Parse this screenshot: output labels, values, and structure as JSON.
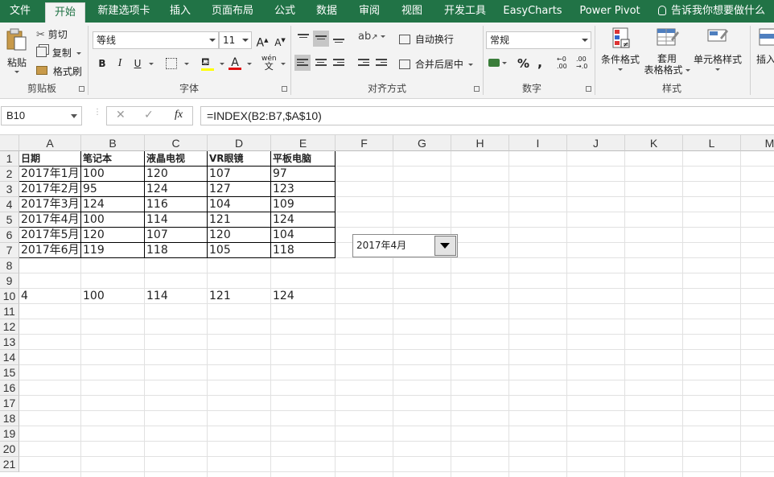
{
  "menu": {
    "tabs": [
      "文件",
      "开始",
      "新建选项卡",
      "插入",
      "页面布局",
      "公式",
      "数据",
      "审阅",
      "视图",
      "开发工具",
      "EasyCharts",
      "Power Pivot"
    ],
    "active_tab": "开始",
    "tell_me": "告诉我你想要做什么"
  },
  "ribbon": {
    "clipboard": {
      "paste": "粘贴",
      "cut": "剪切",
      "copy": "复制",
      "format_painter": "格式刷",
      "label": "剪贴板"
    },
    "font": {
      "font_name": "等线",
      "font_size": "11",
      "bold": "B",
      "italic": "I",
      "underline": "U",
      "grow": "A",
      "shrink": "A",
      "font_color": "A",
      "phonetic": "wén",
      "phonetic_char": "文",
      "label": "字体"
    },
    "alignment": {
      "wrap_text": "自动换行",
      "merge_center": "合并后居中",
      "label": "对齐方式"
    },
    "number": {
      "format": "常规",
      "percent": "%",
      "comma": ",",
      "inc_decimal_top": "←0",
      "inc_decimal_bottom": ".00",
      "dec_decimal_top": ".00",
      "dec_decimal_bottom": "→.0",
      "label": "数字"
    },
    "styles": {
      "conditional": "条件格式",
      "table_line1": "套用",
      "table_line2": "表格格式",
      "cell_styles": "单元格样式",
      "label": "样式"
    },
    "cells": {
      "insert": "插入"
    }
  },
  "formula_bar": {
    "name_box": "B10",
    "cancel": "✕",
    "enter": "✓",
    "fx": "fx",
    "formula": "=INDEX(B2:B7,$A$10)"
  },
  "sheet": {
    "columns": [
      "A",
      "B",
      "C",
      "D",
      "E",
      "F",
      "G",
      "H",
      "I",
      "J",
      "K",
      "L",
      "M"
    ],
    "rows": [
      "1",
      "2",
      "3",
      "4",
      "5",
      "6",
      "7",
      "8",
      "9",
      "10",
      "11",
      "12",
      "13",
      "14",
      "15",
      "16",
      "17",
      "18",
      "19",
      "20",
      "21"
    ],
    "table_header": [
      "日期",
      "笔记本",
      "液晶电视",
      "VR眼镜",
      "平板电脑"
    ],
    "table_rows": [
      [
        "2017年1月",
        "100",
        "120",
        "107",
        "97"
      ],
      [
        "2017年2月",
        "95",
        "124",
        "127",
        "123"
      ],
      [
        "2017年3月",
        "124",
        "116",
        "104",
        "109"
      ],
      [
        "2017年4月",
        "100",
        "114",
        "121",
        "124"
      ],
      [
        "2017年5月",
        "120",
        "107",
        "120",
        "104"
      ],
      [
        "2017年6月",
        "119",
        "118",
        "105",
        "118"
      ]
    ],
    "row10": [
      "4",
      "100",
      "114",
      "121",
      "124"
    ]
  },
  "combo_box": {
    "selected": "2017年4月"
  }
}
